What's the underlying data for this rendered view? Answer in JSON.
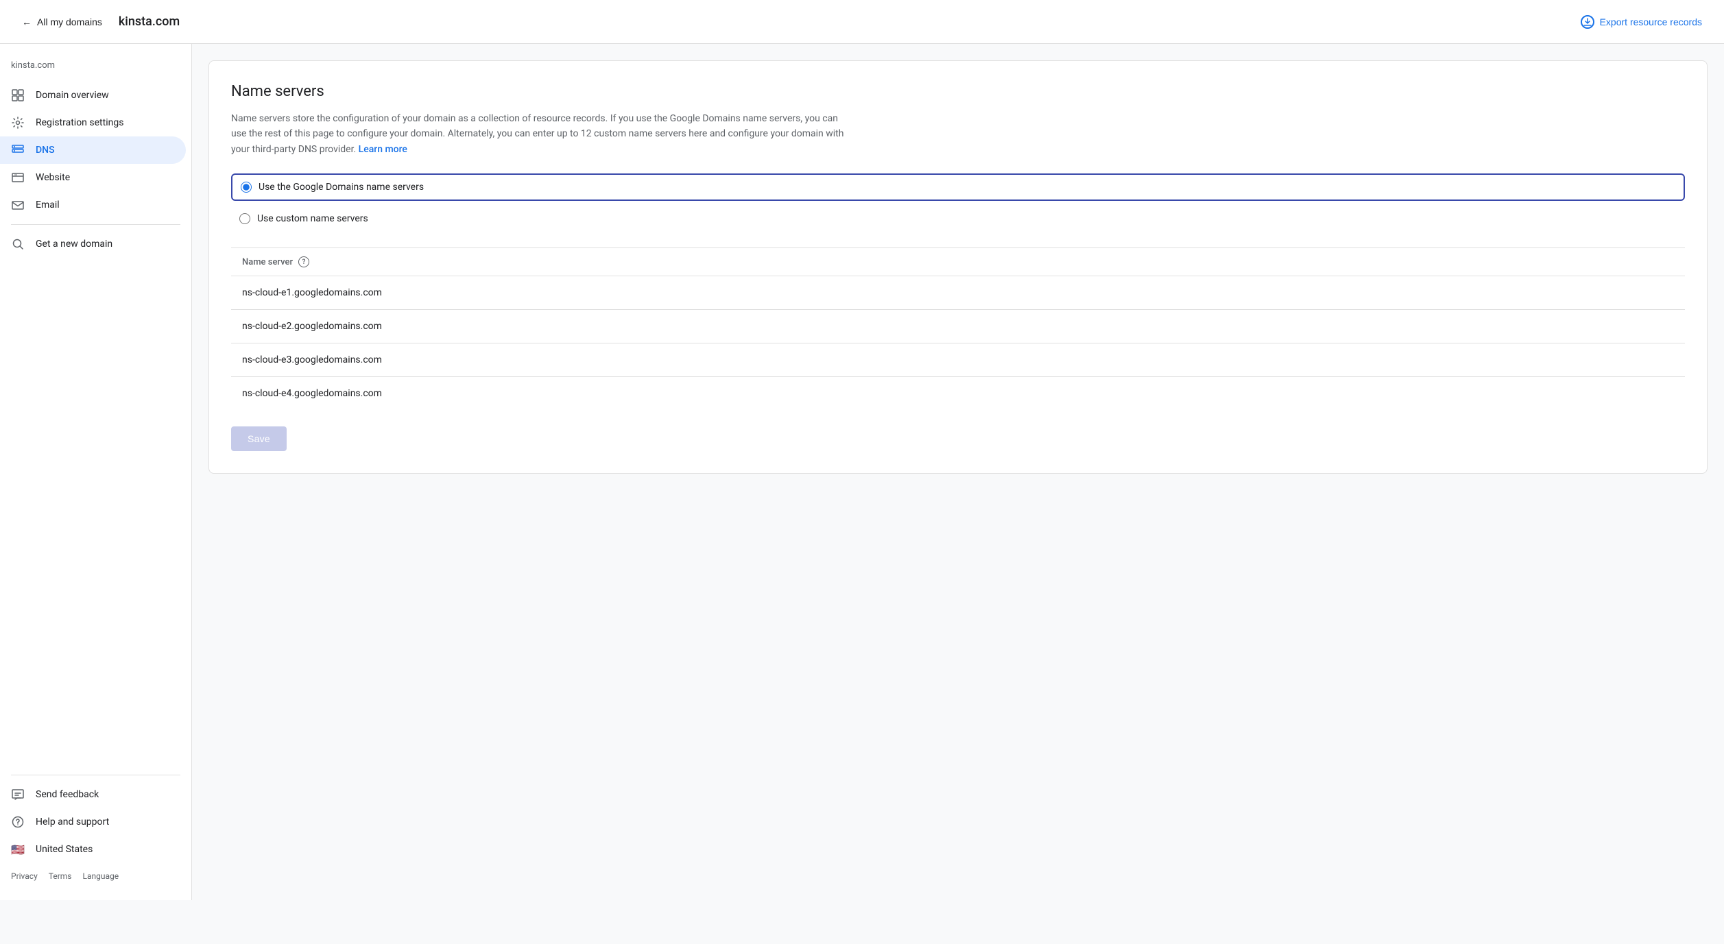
{
  "header": {
    "back_label": "All my domains",
    "domain_title": "kinsta.com",
    "export_label": "Export resource records"
  },
  "sidebar": {
    "domain_label": "kinsta.com",
    "items": [
      {
        "id": "domain-overview",
        "label": "Domain overview",
        "icon": "grid-icon"
      },
      {
        "id": "registration-settings",
        "label": "Registration settings",
        "icon": "settings-icon"
      },
      {
        "id": "dns",
        "label": "DNS",
        "icon": "dns-icon",
        "active": true
      },
      {
        "id": "website",
        "label": "Website",
        "icon": "website-icon"
      },
      {
        "id": "email",
        "label": "Email",
        "icon": "email-icon"
      }
    ],
    "divider_items": [
      {
        "id": "get-new-domain",
        "label": "Get a new domain",
        "icon": "search-icon"
      }
    ],
    "bottom_items": [
      {
        "id": "send-feedback",
        "label": "Send feedback",
        "icon": "feedback-icon"
      },
      {
        "id": "help-support",
        "label": "Help and support",
        "icon": "help-icon"
      },
      {
        "id": "united-states",
        "label": "United States",
        "icon": "flag-icon"
      }
    ],
    "footer": {
      "privacy": "Privacy",
      "terms": "Terms",
      "language": "Language"
    }
  },
  "main": {
    "card": {
      "title": "Name servers",
      "description": "Name servers store the configuration of your domain as a collection of resource records. If you use the Google Domains name servers, you can use the rest of this page to configure your domain. Alternately, you can enter up to 12 custom name servers here and configure your domain with your third-party DNS provider.",
      "learn_more": "Learn more",
      "radio_google": "Use the Google Domains name servers",
      "radio_custom": "Use custom name servers",
      "ns_column_label": "Name server",
      "name_servers": [
        "ns-cloud-e1.googledomains.com",
        "ns-cloud-e2.googledomains.com",
        "ns-cloud-e3.googledomains.com",
        "ns-cloud-e4.googledomains.com"
      ],
      "save_label": "Save"
    }
  },
  "colors": {
    "active_blue": "#1a73e8",
    "active_bg": "#e8f0fe",
    "border_selected": "#3949ab",
    "save_bg": "#c5cae9",
    "text_muted": "#5f6368",
    "divider": "#e0e0e0"
  }
}
